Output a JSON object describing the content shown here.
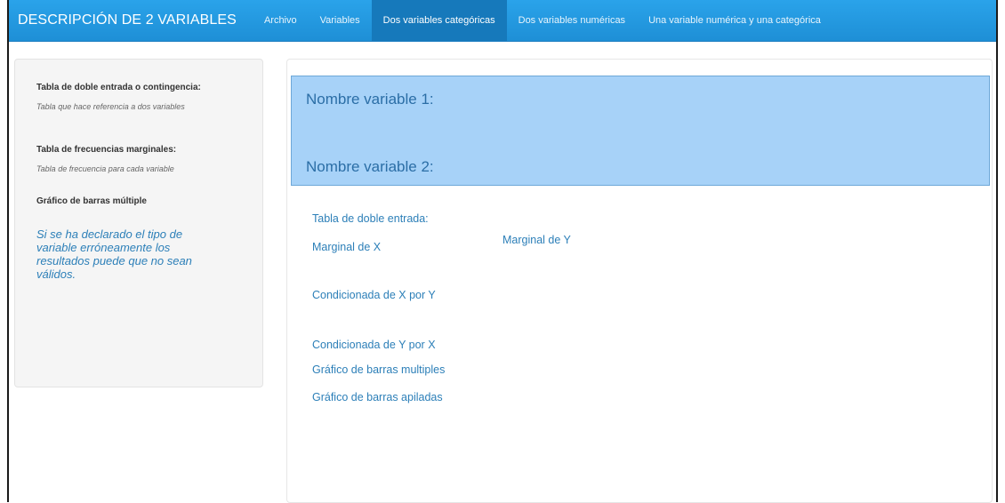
{
  "navbar": {
    "brand": "DESCRIPCIÓN DE 2 VARIABLES",
    "items": [
      {
        "label": "Archivo",
        "active": false
      },
      {
        "label": "Variables",
        "active": false
      },
      {
        "label": "Dos variables categóricas",
        "active": true
      },
      {
        "label": "Dos variables numéricas",
        "active": false
      },
      {
        "label": "Una variable numérica y una categórica",
        "active": false
      }
    ]
  },
  "sidebar": {
    "sections": [
      {
        "heading": "Tabla de doble entrada o contingencia:",
        "description": "Tabla que hace referencia a dos variables"
      },
      {
        "heading": "Tabla de frecuencias marginales:",
        "description": "Tabla de frecuencia para cada variable"
      },
      {
        "heading": "Gráfico de barras múltiple"
      }
    ],
    "warning": "Si se ha declarado el tipo de variable erróneamente los resultados puede que no sean válidos."
  },
  "main": {
    "variable1_label": "Nombre variable 1:",
    "variable2_label": "Nombre variable 2:",
    "outputs": {
      "doble_entrada": "Tabla de doble entrada:",
      "marginal_x": "Marginal de X",
      "marginal_y": "Marginal de Y",
      "condicionada_x_y": "Condicionada de X por Y",
      "condicionada_y_x": "Condicionada de Y por X",
      "barras_multiples": "Gráfico de barras multiples",
      "barras_apiladas": "Gráfico de barras apiladas"
    }
  },
  "colors": {
    "navbar": "#1e8fd6",
    "active_tab": "#1679bb",
    "variable_panel": "#a7d2f8",
    "link_text": "#2c7fb8",
    "sidebar_bg": "#f5f5f5"
  }
}
